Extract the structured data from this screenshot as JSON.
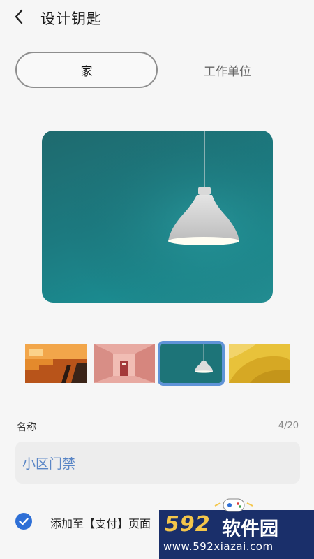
{
  "header": {
    "title": "设计钥匙",
    "back_icon": "chevron-left-icon"
  },
  "tabs": [
    {
      "label": "家",
      "active": true
    },
    {
      "label": "工作单位",
      "active": false
    }
  ],
  "hero": {
    "image": "pendant-lamp-on-teal-wall"
  },
  "thumbnails": [
    {
      "image": "orange-staircase",
      "selected": false
    },
    {
      "image": "pink-hallway-door",
      "selected": false
    },
    {
      "image": "pendant-lamp-teal",
      "selected": true
    },
    {
      "image": "yellow-chair-detail",
      "selected": false
    }
  ],
  "name": {
    "label": "名称",
    "count": "4/20",
    "value": "小区门禁"
  },
  "add_to_pay": {
    "label": "添加至【支付】页面",
    "checked": true
  },
  "watermark": {
    "brand_number": "592",
    "brand_text": "软件园",
    "url": "www.592xiazai.com"
  },
  "colors": {
    "accent": "#2e6fd6",
    "name_value": "#5a86c6",
    "hero_teal": "#1c7a80"
  }
}
